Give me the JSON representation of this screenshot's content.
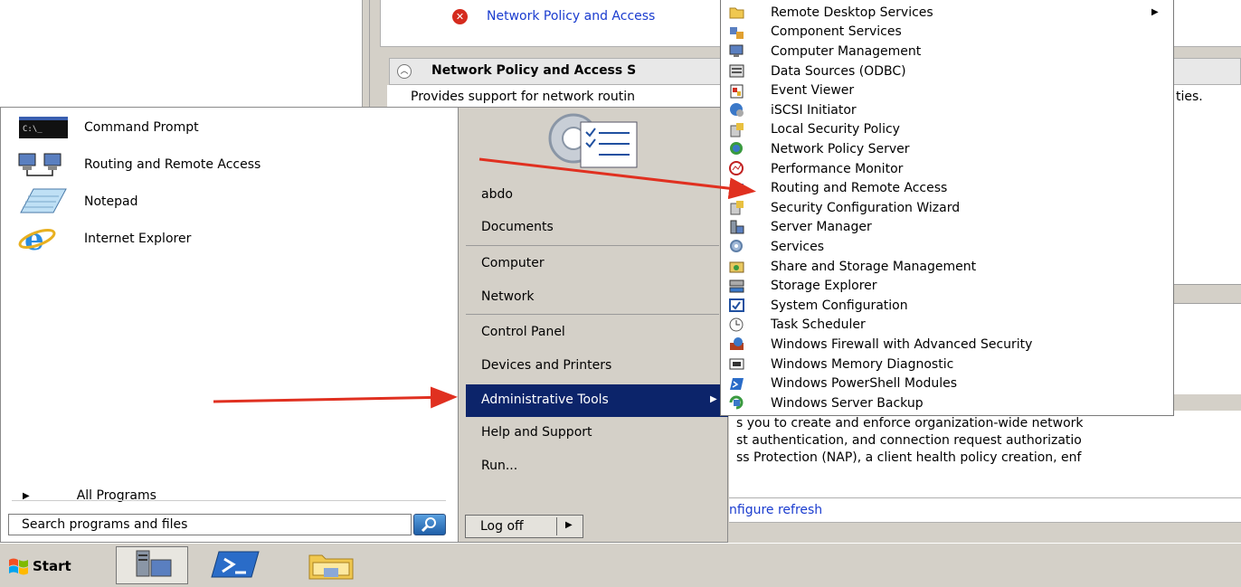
{
  "background_window": {
    "error_link": "Network Policy and Access",
    "section_title": "Network Policy and Access S",
    "description": "Provides support for network routin",
    "description_tail": "ties.",
    "detail_lines": [
      "s you to create and enforce organization-wide network",
      "st authentication, and connection request authorizatio",
      "ss Protection (NAP), a client health policy creation, enf"
    ],
    "refresh_link": "nfigure refresh"
  },
  "start_menu": {
    "pinned": [
      {
        "label": "Command Prompt",
        "icon": "command-prompt-icon"
      },
      {
        "label": "Routing and Remote Access",
        "icon": "network-computers-icon"
      },
      {
        "label": "Notepad",
        "icon": "notepad-icon"
      },
      {
        "label": "Internet Explorer",
        "icon": "internet-explorer-icon"
      }
    ],
    "all_programs": "All Programs",
    "search_placeholder": "Search programs and files",
    "right": {
      "user": "abdo",
      "documents": "Documents",
      "computer": "Computer",
      "network": "Network",
      "control_panel": "Control Panel",
      "devices": "Devices and Printers",
      "admin_tools": "Administrative Tools",
      "help": "Help and Support",
      "run": "Run..."
    },
    "log_off": "Log off"
  },
  "admin_tools": [
    {
      "label": "Remote Desktop Services",
      "icon": "folder-icon",
      "has_submenu": true
    },
    {
      "label": "Component Services",
      "icon": "component-services-icon"
    },
    {
      "label": "Computer Management",
      "icon": "computer-management-icon"
    },
    {
      "label": "Data Sources (ODBC)",
      "icon": "data-sources-icon"
    },
    {
      "label": "Event Viewer",
      "icon": "event-viewer-icon"
    },
    {
      "label": "iSCSI Initiator",
      "icon": "iscsi-icon"
    },
    {
      "label": "Local Security Policy",
      "icon": "security-policy-icon"
    },
    {
      "label": "Network Policy Server",
      "icon": "network-policy-icon"
    },
    {
      "label": "Performance Monitor",
      "icon": "performance-monitor-icon"
    },
    {
      "label": "Routing and Remote Access",
      "icon": "routing-icon"
    },
    {
      "label": "Security Configuration Wizard",
      "icon": "security-wizard-icon"
    },
    {
      "label": "Server Manager",
      "icon": "server-manager-icon"
    },
    {
      "label": "Services",
      "icon": "services-gear-icon"
    },
    {
      "label": "Share and Storage Management",
      "icon": "share-storage-icon"
    },
    {
      "label": "Storage Explorer",
      "icon": "storage-explorer-icon"
    },
    {
      "label": "System Configuration",
      "icon": "system-configuration-icon"
    },
    {
      "label": "Task Scheduler",
      "icon": "task-scheduler-icon"
    },
    {
      "label": "Windows Firewall with Advanced Security",
      "icon": "firewall-icon"
    },
    {
      "label": "Windows Memory Diagnostic",
      "icon": "memory-diagnostic-icon"
    },
    {
      "label": "Windows PowerShell Modules",
      "icon": "powershell-icon"
    },
    {
      "label": "Windows Server Backup",
      "icon": "server-backup-icon"
    }
  ],
  "taskbar": {
    "start_label": "Start",
    "buttons": [
      "server-manager-icon",
      "powershell-icon",
      "explorer-folder-icon"
    ]
  },
  "colors": {
    "highlight": "#0c246a",
    "annotation_arrow": "#e03020",
    "link": "#1a3ccf"
  }
}
